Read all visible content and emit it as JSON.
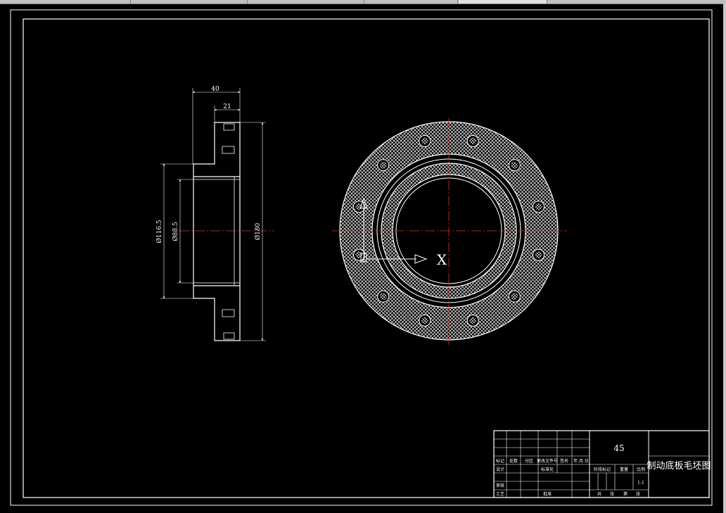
{
  "colors": {
    "background": "#000000",
    "line": "#ffffff",
    "centerline": "#ff2020",
    "hatch": "#ffffff"
  },
  "section_view": {
    "dim_overall_width": "40",
    "dim_flange_width": "21",
    "dim_bore_outer": "Ø116.5",
    "dim_bore_inner": "Ø88.5",
    "dim_outer": "Ø180"
  },
  "front_view": {
    "section_marker": "X"
  },
  "title_block": {
    "material": "45",
    "drawing_title": "制动底板毛坯图",
    "scale_value": "1:1",
    "row_labels": [
      "标记",
      "处数",
      "分区",
      "更改文件号",
      "签名",
      "年.月.日"
    ],
    "designer": "设计",
    "standardization": "标准化",
    "checker": "审核",
    "process": "工艺",
    "approve": "批准",
    "stage_labels": [
      "阶段标记",
      "重量",
      "比例"
    ],
    "sheet_labels": [
      "共",
      "张",
      "第",
      "张"
    ]
  }
}
